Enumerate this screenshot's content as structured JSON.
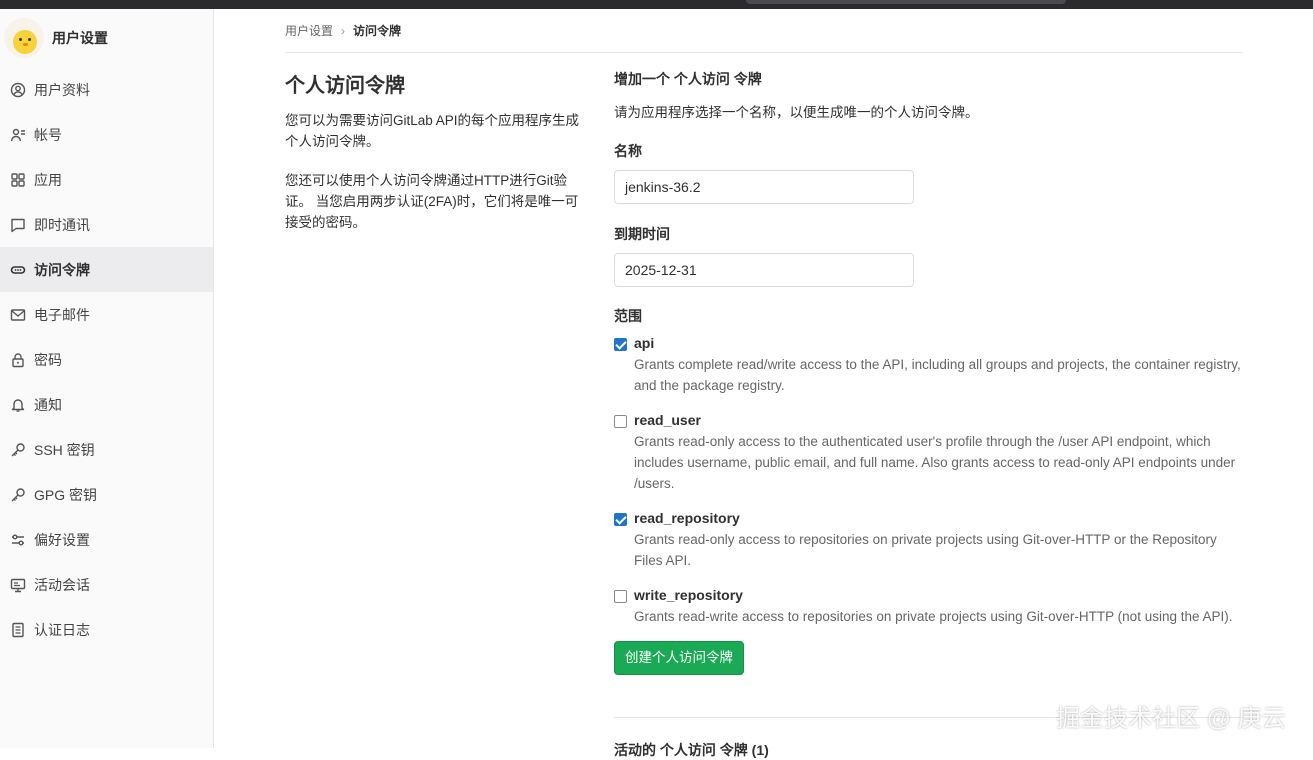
{
  "sidebar": {
    "title": "用户设置",
    "items": [
      {
        "label": "用户资料",
        "icon": "profile-icon"
      },
      {
        "label": "帐号",
        "icon": "account-icon"
      },
      {
        "label": "应用",
        "icon": "applications-icon"
      },
      {
        "label": "即时通讯",
        "icon": "chat-icon"
      },
      {
        "label": "访问令牌",
        "icon": "token-icon",
        "active": true
      },
      {
        "label": "电子邮件",
        "icon": "mail-icon"
      },
      {
        "label": "密码",
        "icon": "lock-icon"
      },
      {
        "label": "通知",
        "icon": "bell-icon"
      },
      {
        "label": "SSH 密钥",
        "icon": "key-icon"
      },
      {
        "label": "GPG 密钥",
        "icon": "key-icon"
      },
      {
        "label": "偏好设置",
        "icon": "preferences-icon"
      },
      {
        "label": "活动会话",
        "icon": "monitor-icon"
      },
      {
        "label": "认证日志",
        "icon": "log-icon"
      }
    ]
  },
  "breadcrumb": {
    "parent": "用户设置",
    "current": "访问令牌"
  },
  "intro": {
    "title": "个人访问令牌",
    "desc1": "您可以为需要访问GitLab API的每个应用程序生成个人访问令牌。",
    "desc2": "您还可以使用个人访问令牌通过HTTP进行Git验证。 当您启用两步认证(2FA)时，它们将是唯一可接受的密码。"
  },
  "form": {
    "title": "增加一个 个人访问 令牌",
    "desc": "请为应用程序选择一个名称，以便生成唯一的个人访问令牌。",
    "name_label": "名称",
    "name_value": "jenkins-36.2",
    "expires_label": "到期时间",
    "expires_value": "2025-12-31",
    "scopes_label": "范围",
    "scopes": [
      {
        "name": "api",
        "checked": true,
        "help": "Grants complete read/write access to the API, including all groups and projects, the container registry, and the package registry."
      },
      {
        "name": "read_user",
        "checked": false,
        "help": "Grants read-only access to the authenticated user's profile through the /user API endpoint, which includes username, public email, and full name. Also grants access to read-only API endpoints under /users."
      },
      {
        "name": "read_repository",
        "checked": true,
        "help": "Grants read-only access to repositories on private projects using Git-over-HTTP or the Repository Files API."
      },
      {
        "name": "write_repository",
        "checked": false,
        "help": "Grants read-write access to repositories on private projects using Git-over-HTTP (not using the API)."
      }
    ],
    "submit_label": "创建个人访问令牌"
  },
  "active_tokens_title": "活动的 个人访问 令牌 (1)",
  "watermark": "掘金技术社区 @ 庚云",
  "colors": {
    "primary": "#1f75cb",
    "success": "#1aaa55",
    "sidebar_bg": "#fafafa",
    "topbar": "#2b2b2e"
  }
}
